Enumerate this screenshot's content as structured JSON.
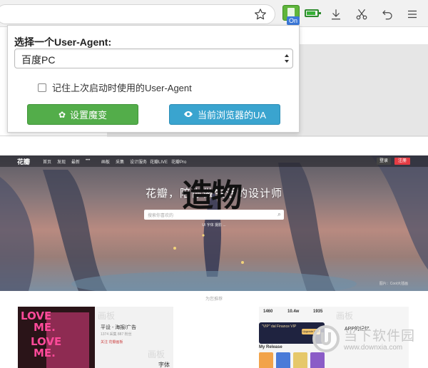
{
  "toolbar": {
    "icons": [
      "star-icon",
      "user-agent-extension-icon",
      "battery-icon",
      "download-icon",
      "scissors-icon",
      "undo-icon",
      "menu-icon"
    ],
    "extension_badge": "On"
  },
  "popup": {
    "title": "选择一个User-Agent:",
    "selected_ua": "百度PC",
    "remember_label": "记住上次启动时使用的User-Agent",
    "remember_checked": false,
    "apply_button": "设置魔变",
    "current_ua_button": "当前浏览器的UA",
    "colors": {
      "apply": "#53ad4a",
      "current": "#3aa4cf"
    }
  },
  "site": {
    "logo": "花瓣",
    "nav": [
      "首页",
      "发现",
      "最新",
      "•••",
      "画板",
      "采集",
      "设计服务",
      "花瓣LIVE",
      "花瓣Pro"
    ],
    "login": "登录",
    "signup": "注册",
    "hero_title": "花瓣，陪你做生活的设计师",
    "search_placeholder": "搜索你喜欢的",
    "hero_tags": "UI   字体   摄影   ...",
    "hero_credit": "图片：Cool大插画",
    "recommend": "为您推荐",
    "card_a": {
      "ghost_label": "画板",
      "name": "平设 - 海报/广告",
      "meta": "1374 采集  887 粉丝",
      "follow": "关注  花瓣画板",
      "ghost_label2": "画板",
      "font_label": "字体",
      "poster_lines": [
        "LOVE",
        "ME.",
        "LOVE",
        "ME."
      ]
    },
    "brand_mark": "造物",
    "card_c": {
      "stats": [
        "1460",
        "10.4w",
        "1935"
      ],
      "vip_title": "\"VIP\" dal Finance VIP",
      "vip_button": "Upgrade Now",
      "my_release": "My Release",
      "ghost_label": "画板",
      "app_label": "APP的记忆"
    }
  },
  "watermark": {
    "title": "当下软件园",
    "url": "www.downxia.com"
  }
}
